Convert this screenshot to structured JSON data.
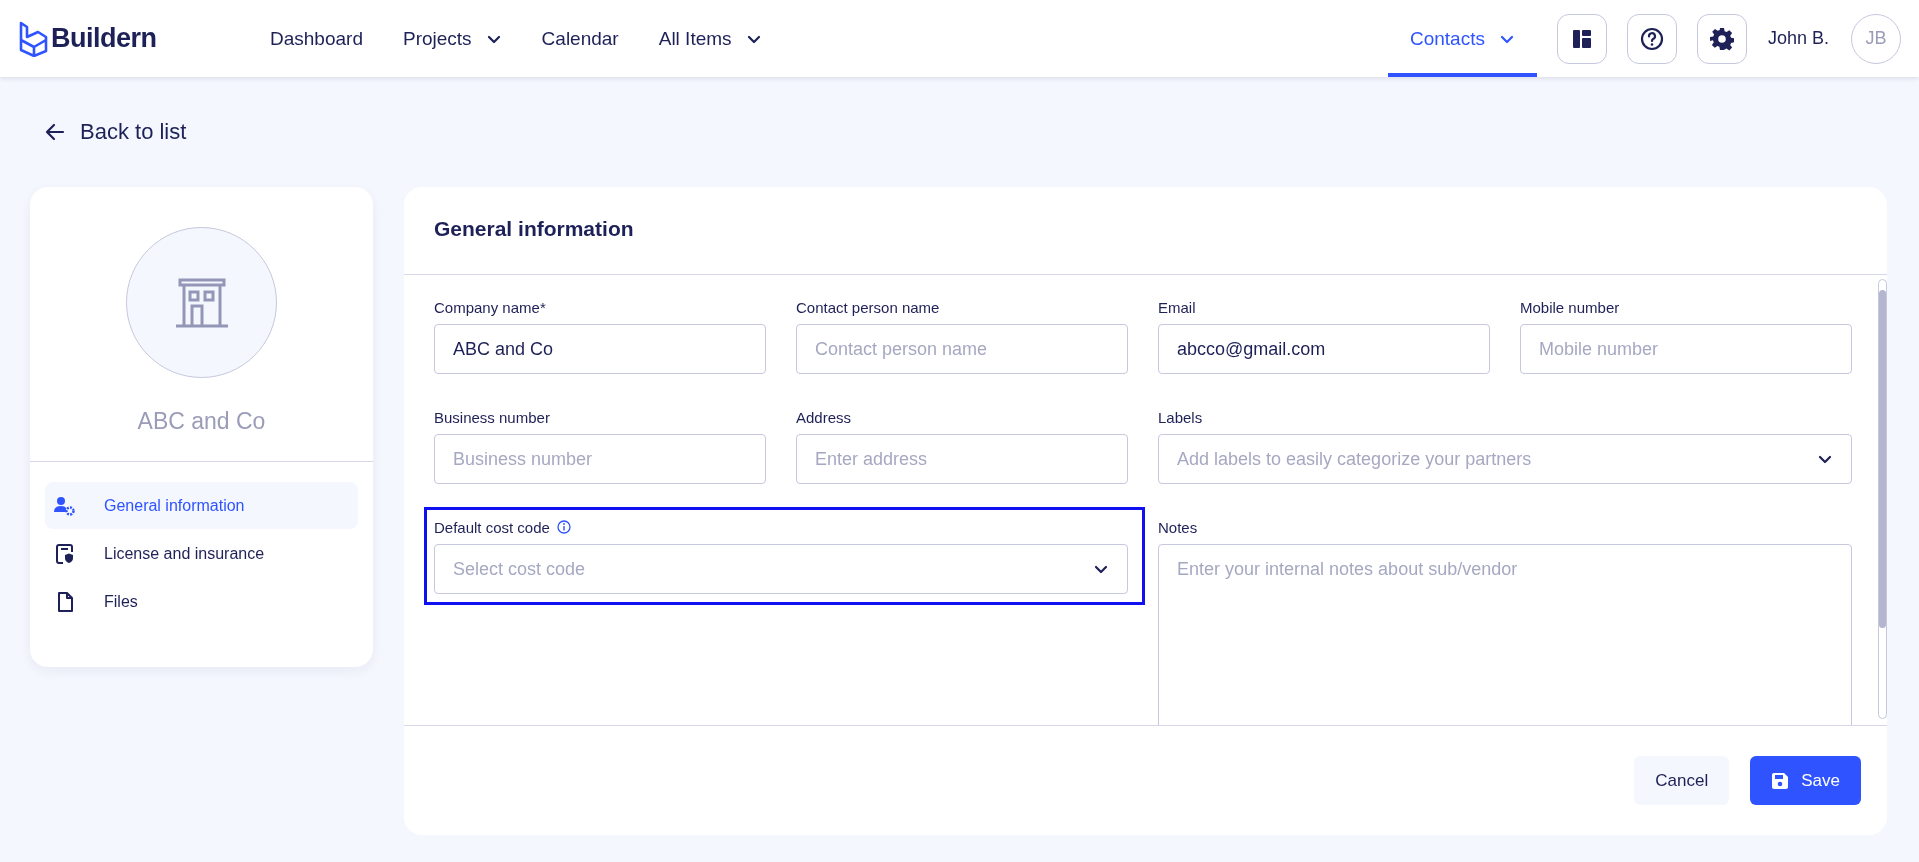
{
  "header": {
    "logo": "Buildern",
    "nav": [
      {
        "label": "Dashboard",
        "dropdown": false,
        "selected": false
      },
      {
        "label": "Projects",
        "dropdown": true,
        "selected": false
      },
      {
        "label": "Calendar",
        "dropdown": false,
        "selected": false
      },
      {
        "label": "All Items",
        "dropdown": true,
        "selected": false
      }
    ],
    "nav_right": [
      {
        "label": "Contacts",
        "dropdown": true,
        "selected": true
      }
    ],
    "user_name": "John B.",
    "avatar": "JB"
  },
  "back_link": "Back to list",
  "company_card": {
    "name": "ABC and Co",
    "menu": [
      {
        "label": "General information",
        "selected": true
      },
      {
        "label": "License and insurance",
        "selected": false
      },
      {
        "label": "Files",
        "selected": false
      }
    ]
  },
  "form": {
    "title": "General information",
    "fields": [
      {
        "kind": "input",
        "label": "Company name*",
        "value": "ABC and Co",
        "info": false,
        "highlighted": false
      },
      {
        "kind": "input",
        "label": "Contact person name",
        "placeholder": "Contact person name",
        "info": false,
        "highlighted": false
      },
      {
        "kind": "input",
        "label": "Email",
        "value": "abcco@gmail.com",
        "info": false,
        "highlighted": false
      },
      {
        "kind": "input",
        "label": "Mobile number",
        "placeholder": "Mobile number",
        "info": false,
        "highlighted": false
      },
      {
        "kind": "input",
        "label": "Business number",
        "placeholder": "Business number",
        "info": false,
        "highlighted": false
      },
      {
        "kind": "input",
        "label": "Address",
        "placeholder": "Enter address",
        "info": false,
        "highlighted": false
      },
      {
        "kind": "select",
        "label": "Labels",
        "placeholder": "Add labels to easily categorize your partners",
        "info": false,
        "highlighted": false
      },
      {
        "kind": "select",
        "label": "Default cost code",
        "placeholder": "Select cost code",
        "info": true,
        "highlighted": true
      },
      {
        "kind": "textarea",
        "label": "Notes",
        "placeholder": "Enter your internal notes about sub/vendor",
        "info": false,
        "highlighted": false
      }
    ],
    "buttons": [
      {
        "kind": "secondary",
        "label": "Cancel"
      },
      {
        "kind": "primary",
        "label": "Save"
      }
    ]
  }
}
